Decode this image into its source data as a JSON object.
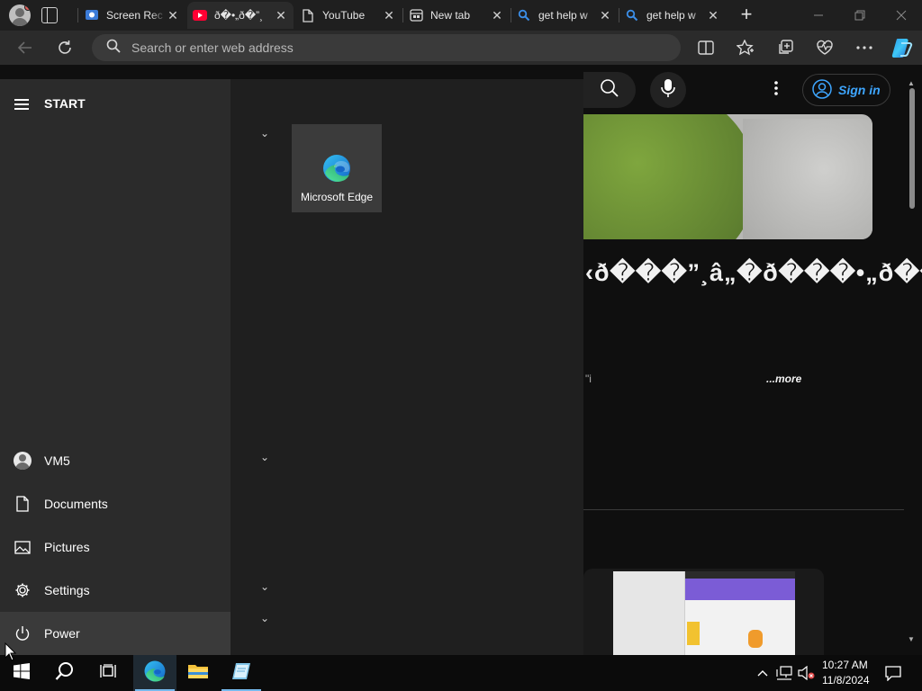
{
  "browser": {
    "tabs": [
      {
        "title": "Screen Rec",
        "favicon": "screen-recorder-icon"
      },
      {
        "title": "ð�•„ð�”¸",
        "favicon": "youtube-icon"
      },
      {
        "title": "YouTube",
        "favicon": "page-icon"
      },
      {
        "title": "New tab",
        "favicon": "newtab-icon"
      },
      {
        "title": "get help w",
        "favicon": "search-icon"
      },
      {
        "title": "get help w",
        "favicon": "search-icon"
      }
    ],
    "address_placeholder": "Search or enter web address"
  },
  "youtube": {
    "signin_label": "Sign in",
    "video_title": "‹ð���”¸â„�ð���•„ð���•€ð���”",
    "description_snippet": "\"i",
    "more_label": "...more"
  },
  "start_menu": {
    "header": "START",
    "user_name": "VM5",
    "items": {
      "documents": "Documents",
      "pictures": "Pictures",
      "settings": "Settings",
      "power": "Power"
    },
    "tile_label": "Microsoft Edge"
  },
  "taskbar": {
    "time": "10:27 AM",
    "date": "11/8/2024"
  },
  "colors": {
    "accent_blue": "#3ea6ff",
    "taskbar_indicator": "#76b9ed",
    "youtube_red": "#ff0033"
  }
}
